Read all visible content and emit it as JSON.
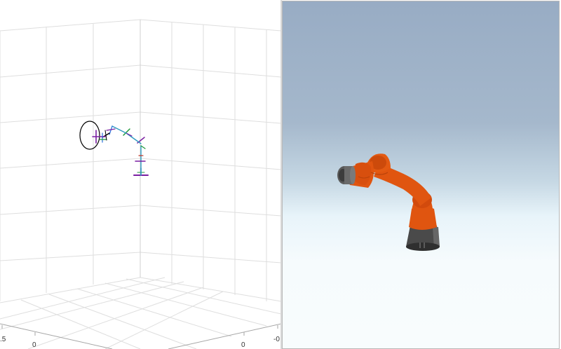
{
  "plot_view": {
    "title": "",
    "tick_labels": {
      "x_left_partial": ".5",
      "x_zero": "0",
      "y_zero": "0",
      "y_neg_partial": "-0"
    },
    "colors": {
      "grid": "#dedede",
      "axis": "#a6a6a6",
      "trajectory": "#000000"
    }
  },
  "robot_view": {
    "colors": {
      "robot_body": "#e05510",
      "robot_base": "#4a4a4a",
      "sky_top": "#98acc4",
      "ground": "#f8fcfd"
    }
  }
}
